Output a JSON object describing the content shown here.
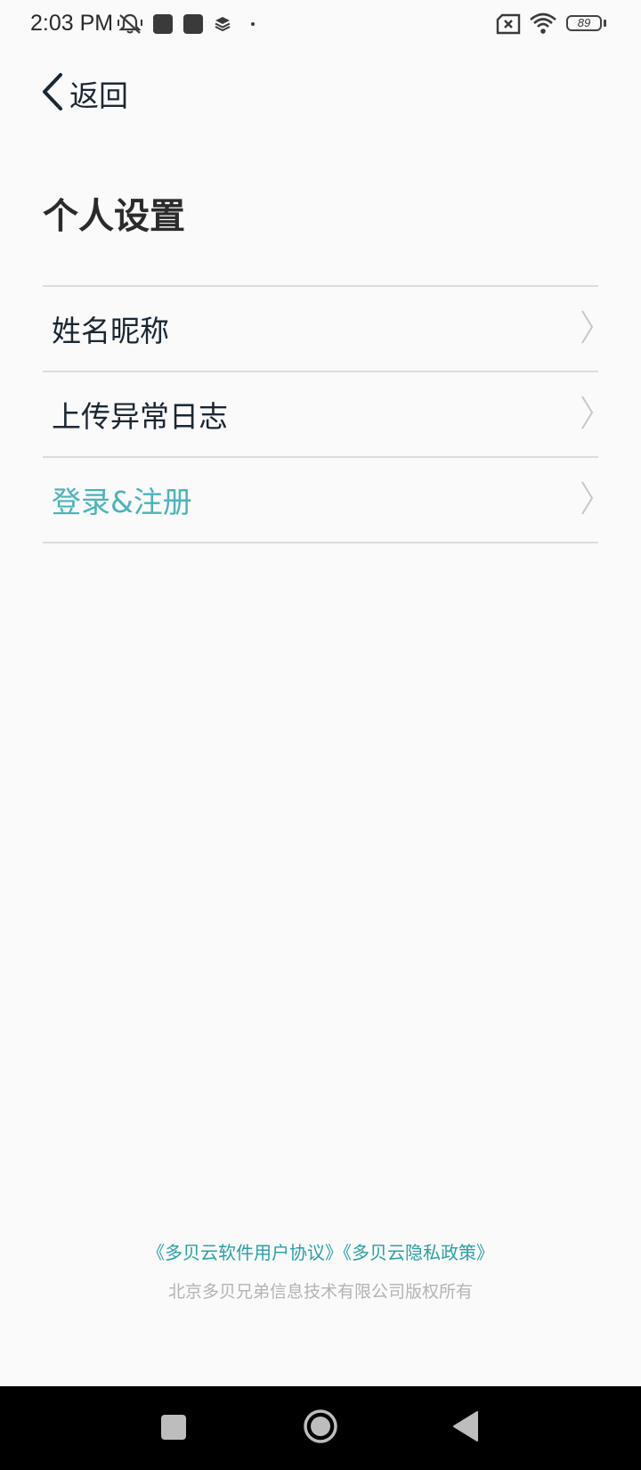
{
  "status_bar": {
    "time": "2:03 PM",
    "battery_level": "89",
    "icons": [
      "mute-vibrate-icon",
      "app-notification-icon",
      "app-notification-icon",
      "layers-icon",
      "dot-icon",
      "no-sim-icon",
      "wifi-icon",
      "battery-icon"
    ]
  },
  "header": {
    "back_label": "返回"
  },
  "page": {
    "title": "个人设置"
  },
  "menu": {
    "items": [
      {
        "label": "姓名昵称"
      },
      {
        "label": "上传异常日志"
      },
      {
        "label": "登录&注册"
      }
    ]
  },
  "footer": {
    "user_agreement": "《多贝云软件用户协议》",
    "privacy_policy": "《多贝云隐私政策》",
    "copyright": "北京多贝兄弟信息技术有限公司版权所有"
  },
  "colors": {
    "accent": "#4ab3bb",
    "link": "#2aa0a6",
    "text": "#1b2733",
    "muted": "#b3b3b3",
    "background": "#fafafa"
  }
}
